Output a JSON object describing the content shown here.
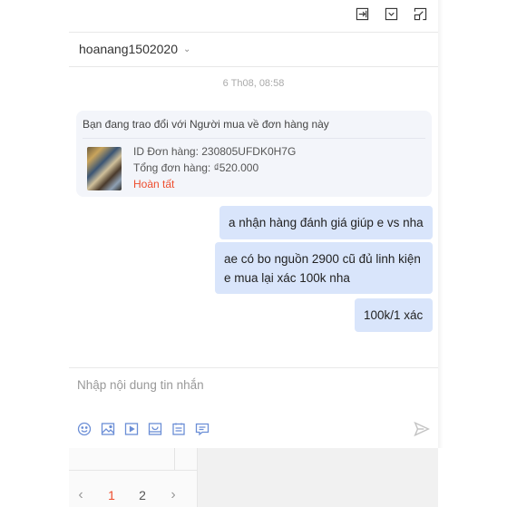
{
  "toolbar": {
    "icons": [
      "exit-icon",
      "minimize-icon",
      "popout-icon"
    ]
  },
  "chat": {
    "username": "hoanang1502020",
    "timestamp": "6 Th08, 08:58"
  },
  "order_card": {
    "intro": "Bạn đang trao đổi với Người mua về đơn hàng này",
    "order_id": "ID Đơn hàng: 230805UFDK0H7G",
    "total": "Tổng đơn hàng: ₫520.000",
    "status": "Hoàn tất"
  },
  "messages": [
    {
      "line1": "a nhận hàng đánh giá giúp e vs nha",
      "line2": ""
    },
    {
      "line1": "ae có bo nguồn 2900 cũ đủ linh kiện",
      "line2": "e mua lại xác 100k nha"
    },
    {
      "line1": "100k/1 xác",
      "line2": ""
    }
  ],
  "composer": {
    "placeholder": "Nhập nội dung tin nhắn",
    "icons": [
      "emoji-icon",
      "image-icon",
      "video-icon",
      "product-icon",
      "order-icon",
      "voucher-icon"
    ],
    "accent_color": "#6b8ed6"
  },
  "pagination": {
    "prev": "‹",
    "pages": [
      "1",
      "2"
    ],
    "next": "›",
    "active_color": "#ee4d2d"
  }
}
